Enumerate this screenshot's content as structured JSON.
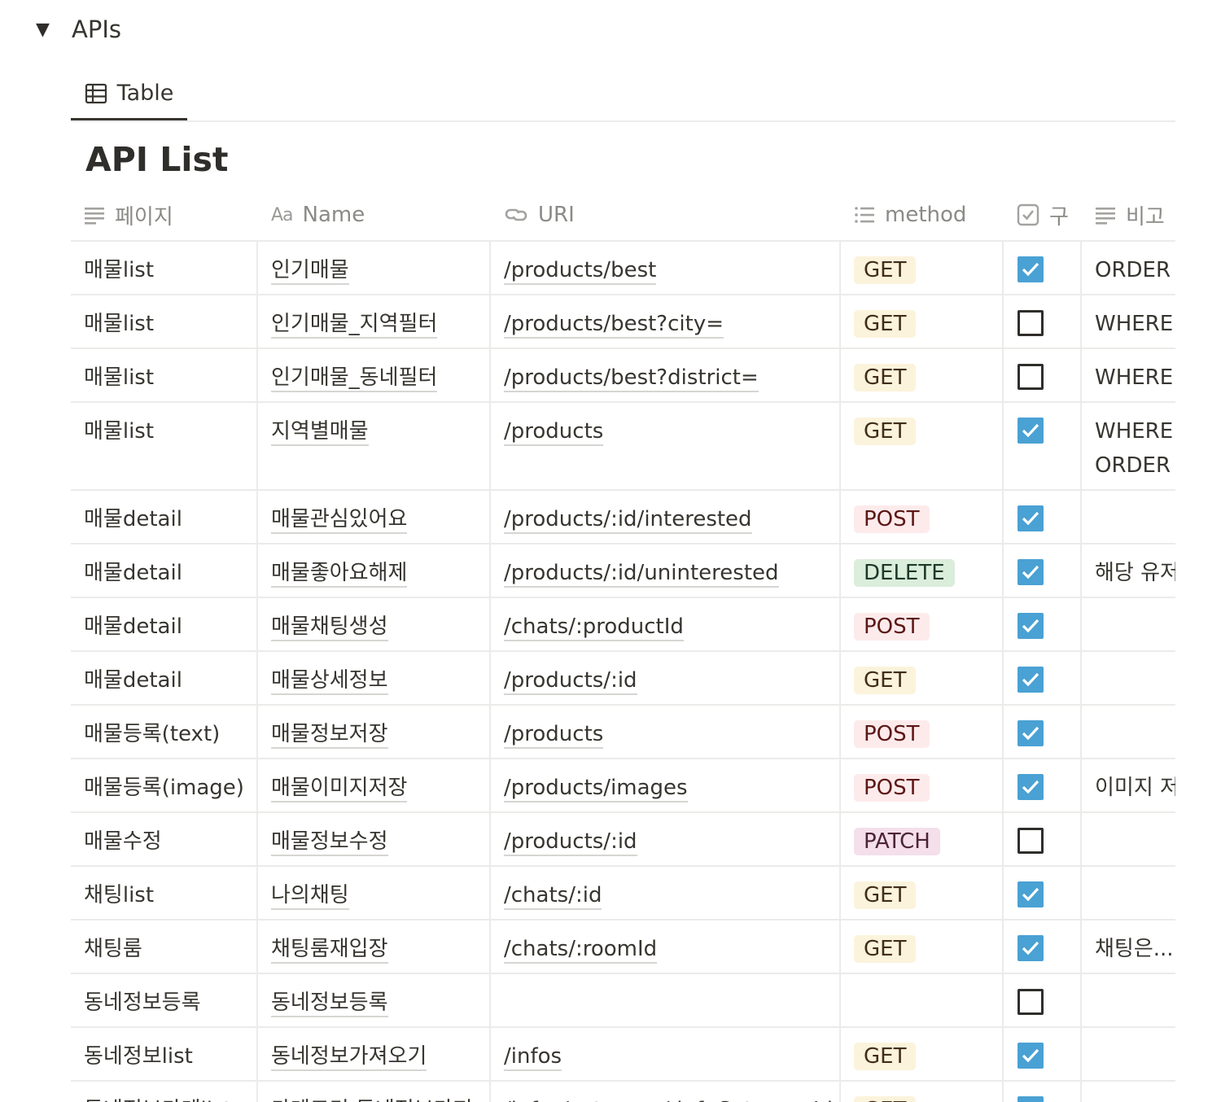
{
  "toggle": {
    "arrow": "▼",
    "title": "APIs"
  },
  "view_tab": {
    "label": "Table",
    "icon": "table-icon"
  },
  "database_title": "API List",
  "columns": {
    "page": "페이지",
    "name": "Name",
    "name_icon": "Aa",
    "uri": "URI",
    "method": "method",
    "check": "구",
    "note": "비고"
  },
  "tag_colors": {
    "GET": {
      "bg": "#fbf3db",
      "fg": "#402c1b"
    },
    "POST": {
      "bg": "#fdebec",
      "fg": "#5d1715"
    },
    "DELETE": {
      "bg": "#dbeddb",
      "fg": "#1c3829"
    },
    "PATCH": {
      "bg": "#f4dfeb",
      "fg": "#4c2337"
    }
  },
  "rows": [
    {
      "page": "매물list",
      "name": "인기매물",
      "uri": "/products/best",
      "method": "GET",
      "checked": true,
      "note": [
        "ORDER"
      ]
    },
    {
      "page": "매물list",
      "name": "인기매물_지역필터",
      "uri": "/products/best?city=",
      "method": "GET",
      "checked": false,
      "note": [
        "WHERE"
      ]
    },
    {
      "page": "매물list",
      "name": "인기매물_동네필터",
      "uri": "/products/best?district=",
      "method": "GET",
      "checked": false,
      "note": [
        "WHERE"
      ]
    },
    {
      "page": "매물list",
      "name": "지역별매물",
      "uri": "/products",
      "method": "GET",
      "checked": true,
      "note": [
        "WHERE",
        "ORDER"
      ]
    },
    {
      "page": "매물detail",
      "name": "매물관심있어요",
      "uri": "/products/:id/interested",
      "method": "POST",
      "checked": true,
      "note": []
    },
    {
      "page": "매물detail",
      "name": "매물좋아요해제",
      "uri": "/products/:id/uninterested",
      "method": "DELETE",
      "checked": true,
      "note": [
        "해당 유저"
      ]
    },
    {
      "page": "매물detail",
      "name": "매물채팅생성",
      "uri": "/chats/:productId",
      "method": "POST",
      "checked": true,
      "note": []
    },
    {
      "page": "매물detail",
      "name": "매물상세정보",
      "uri": "/products/:id",
      "method": "GET",
      "checked": true,
      "note": []
    },
    {
      "page": "매물등록(text)",
      "name": "매물정보저장",
      "uri": "/products",
      "method": "POST",
      "checked": true,
      "note": []
    },
    {
      "page": "매물등록(image)",
      "name": "매물이미지저장",
      "uri": "/products/images",
      "method": "POST",
      "checked": true,
      "note": [
        "이미지 저"
      ]
    },
    {
      "page": "매물수정",
      "name": "매물정보수정",
      "uri": "/products/:id",
      "method": "PATCH",
      "checked": false,
      "note": []
    },
    {
      "page": "채팅list",
      "name": "나의채팅",
      "uri": "/chats/:id",
      "method": "GET",
      "checked": true,
      "note": []
    },
    {
      "page": "채팅룸",
      "name": "채팅룸재입장",
      "uri": "/chats/:roomId",
      "method": "GET",
      "checked": true,
      "note": [
        "채팅은..."
      ]
    },
    {
      "page": "동네정보등록",
      "name": "동네정보등록",
      "uri": "",
      "method": "",
      "checked": false,
      "note": []
    },
    {
      "page": "동네정보list",
      "name": "동네정보가져오기",
      "uri": "/infos",
      "method": "GET",
      "checked": true,
      "note": []
    },
    {
      "page": "동네정보카테list",
      "name": "카테고리 동네정보가져",
      "uri": "/infos/category/:infoCategoryId",
      "method": "GET",
      "checked": true,
      "note": []
    }
  ]
}
